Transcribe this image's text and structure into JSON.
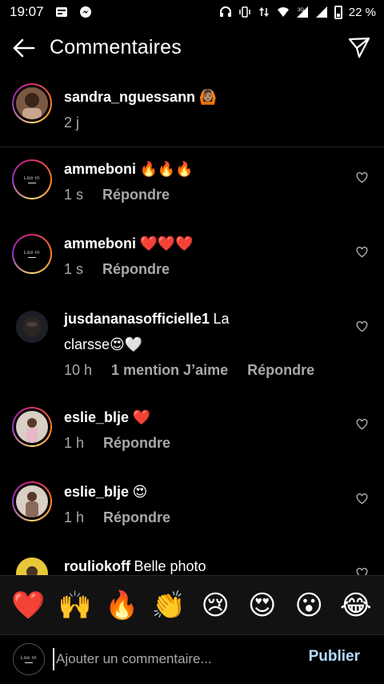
{
  "status_bar": {
    "time": "19:07",
    "battery": "22 %",
    "network": "3G"
  },
  "header": {
    "title": "Commentaires",
    "back_icon": "arrow-left-icon",
    "send_icon": "paper-plane-icon"
  },
  "caption": {
    "username": "sandra_nguessann",
    "emoji": "🙆🏽",
    "time": "2 j"
  },
  "comments": [
    {
      "username": "ammeboni",
      "text": "🔥🔥🔥",
      "time": "1 s",
      "likes": "",
      "reply": "Répondre"
    },
    {
      "username": "ammeboni",
      "text": "❤️❤️❤️",
      "time": "1 s",
      "likes": "",
      "reply": "Répondre"
    },
    {
      "username": "jusdananasofficielle1",
      "text_line1": "La",
      "text_line2": "clarsse😍🤍",
      "time": "10 h",
      "likes": "1 mention J’aime",
      "reply": "Répondre"
    },
    {
      "username": "eslie_blje",
      "text": "❤️",
      "time": "1 h",
      "likes": "",
      "reply": "Répondre"
    },
    {
      "username": "eslie_blje",
      "text": "😍",
      "time": "1 h",
      "likes": "",
      "reply": "Répondre"
    },
    {
      "username": "rouliokoff",
      "text": "Belle photo",
      "time": "",
      "likes": "",
      "reply": ""
    }
  ],
  "emoji_bar": [
    "❤️",
    "🙌",
    "🔥",
    "👏",
    "😢",
    "😍",
    "😮",
    "😂"
  ],
  "input": {
    "placeholder": "Ajouter un commentaire...",
    "publish_label": "Publier"
  },
  "avatar_logo_text": "Loo rn",
  "colors": {
    "background": "#000000",
    "muted": "#a8a8a8",
    "publish": "#b3dbff",
    "divider": "#262626"
  }
}
